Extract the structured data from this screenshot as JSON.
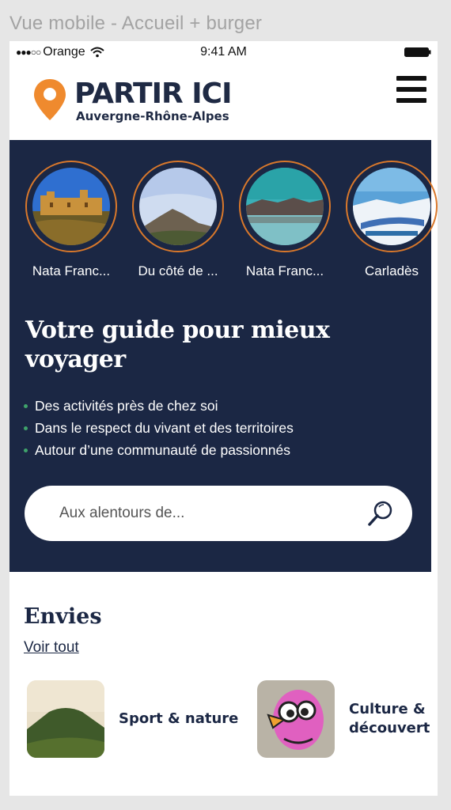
{
  "artboard_title": "Vue mobile - Accueil + burger",
  "statusbar": {
    "carrier": "Orange",
    "time": "9:41 AM"
  },
  "header": {
    "logo_title": "PARTIR ICI",
    "logo_subtitle": "Auvergne-Rhône-Alpes"
  },
  "stories": [
    {
      "label": "Nata Franc...",
      "image": "castle"
    },
    {
      "label": "Du côté de ...",
      "image": "mountain"
    },
    {
      "label": "Nata Franc...",
      "image": "lake"
    },
    {
      "label": "Carladès",
      "image": "snow"
    }
  ],
  "hero": {
    "title": "Votre guide pour mieux voyager",
    "bullets": [
      "Des activités près de chez soi",
      "Dans le respect du vivant et des territoires",
      "Autour d’une communauté de passionnés"
    ],
    "search_placeholder": "Aux alentours de..."
  },
  "envies": {
    "title": "Envies",
    "see_all": "Voir tout",
    "categories": [
      {
        "label": "Sport & nature"
      },
      {
        "label": "Culture & découvert"
      }
    ]
  },
  "colors": {
    "navy": "#1b2744",
    "orange": "#d9782b",
    "bullet": "#3fa36b"
  }
}
